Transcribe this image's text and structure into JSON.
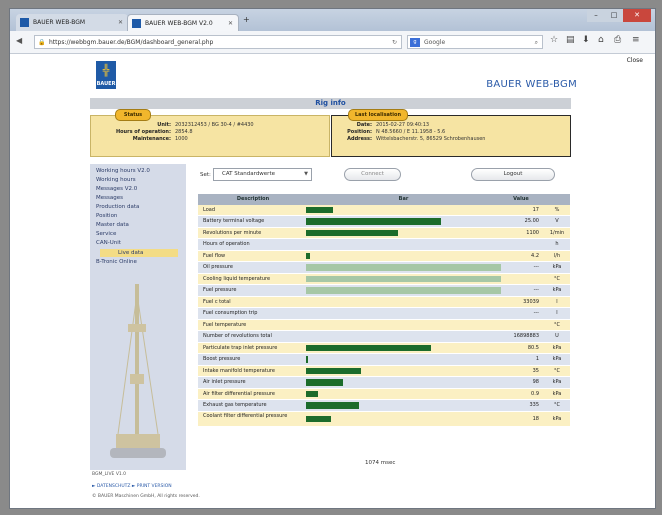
{
  "browser": {
    "tabs": [
      {
        "label": "BAUER WEB-BGM"
      },
      {
        "label": "BAUER WEB-BGM V2.0"
      }
    ],
    "url": "https://webbgm.bauer.de/BGM/dashboard_general.php",
    "search_placeholder": "Google"
  },
  "page": {
    "close_label": "Close",
    "logo_text": "BAUER",
    "brand": "BAUER WEB-BGM",
    "section_title": "Rig info"
  },
  "status": {
    "title": "Status",
    "unit_label": "Unit:",
    "unit_value": "2032312453 / BG 30-4 / #4430",
    "hours_label": "Hours of operation:",
    "hours_value": "2854.8",
    "maint_label": "Maintenance:",
    "maint_value": "1000"
  },
  "last_location": {
    "title": "Last localisation",
    "date_label": "Date:",
    "date_value": "2015-02-27 09:40:13",
    "position_label": "Position:",
    "position_value": "N 48.5660 / E 11.1958 - 5.6",
    "address_label": "Address:",
    "address_value": "Wittelsbacherstr. 5, 86529 Schrobenhausen"
  },
  "sidebar": {
    "items": [
      {
        "label": "Working hours V2.0"
      },
      {
        "label": "Working hours"
      },
      {
        "label": "Messages V2.0"
      },
      {
        "label": "Messages"
      },
      {
        "label": "Production data"
      },
      {
        "label": "Position"
      },
      {
        "label": "Master data"
      },
      {
        "label": "Service"
      },
      {
        "label": "CAN-Unit"
      },
      {
        "label": "Live data"
      },
      {
        "label": "B-Tronic Online"
      }
    ]
  },
  "controls": {
    "set_label": "Set:",
    "set_value": "CAT Standardwerte",
    "connect_label": "Connect",
    "logout_label": "Logout"
  },
  "table": {
    "headers": {
      "description": "Description",
      "bar": "Bar",
      "value": "Value"
    },
    "rows": [
      {
        "description": "Load",
        "level": 0.14,
        "value": "17",
        "unit": "%"
      },
      {
        "description": "Battery terminal voltage",
        "level": 0.69,
        "value": "25.00",
        "unit": "V"
      },
      {
        "description": "Revolutions per minute",
        "level": 0.47,
        "value": "1100",
        "unit": "1/min"
      },
      {
        "description": "Hours of operation",
        "level": 0,
        "value": "",
        "unit": "h"
      },
      {
        "description": "Fuel flow",
        "level": 0.02,
        "value": "4.2",
        "unit": "l/h"
      },
      {
        "description": "Oil pressure",
        "level": 1.0,
        "light": true,
        "value": "---",
        "unit": "kPa"
      },
      {
        "description": "Cooling liquid temperature",
        "level": 1.0,
        "light": true,
        "value": "",
        "unit": "°C"
      },
      {
        "description": "Fuel pressure",
        "level": 1.0,
        "light": true,
        "value": "---",
        "unit": "kPa"
      },
      {
        "description": "Fuel c total",
        "level": 0,
        "value": "33039",
        "unit": "l"
      },
      {
        "description": "Fuel consumption trip",
        "level": 0,
        "value": "---",
        "unit": "l"
      },
      {
        "description": "Fuel temperature",
        "level": 0,
        "value": "",
        "unit": "°C"
      },
      {
        "description": "Number of revolutions total",
        "level": 0,
        "value": "16898883",
        "unit": "U"
      },
      {
        "description": "Particulate trap inlet pressure",
        "level": 0.64,
        "value": "80.5",
        "unit": "kPa"
      },
      {
        "description": "Boost pressure",
        "level": 0.01,
        "value": "1",
        "unit": "kPa"
      },
      {
        "description": "Intake manifold temperature",
        "level": 0.28,
        "value": "35",
        "unit": "°C"
      },
      {
        "description": "Air inlet pressure",
        "level": 0.19,
        "value": "98",
        "unit": "kPa"
      },
      {
        "description": "Air filter differential pressure",
        "level": 0.06,
        "value": "0.9",
        "unit": "kPa"
      },
      {
        "description": "Exhaust gas temperature",
        "level": 0.27,
        "value": "335",
        "unit": "°C"
      },
      {
        "description": "Coolant filter differential pressure",
        "level": 0.13,
        "value": "18",
        "unit": "kPa"
      }
    ]
  },
  "time_text": "1074 msec",
  "footer": {
    "version": "BGM_LIVE V1.0",
    "links": "► DATENSCHUTZ  ► PRINT VERSION",
    "copyright": "© BAUER Maschinen GmbH, All rights reserved."
  }
}
